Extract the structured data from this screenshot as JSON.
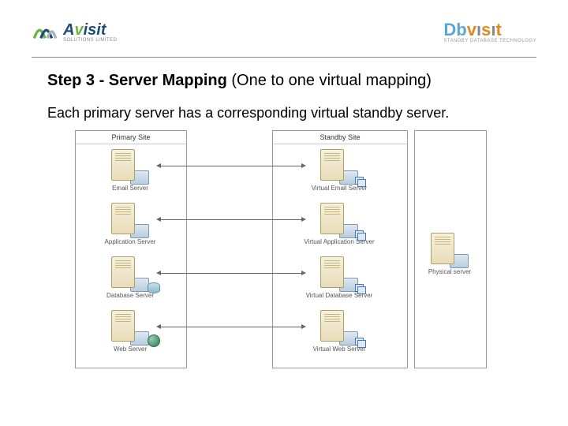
{
  "logos": {
    "avisit": {
      "name": "Avisit",
      "sub": "SOLUTIONS LIMITED"
    },
    "dbvisit": {
      "name": "Dbvisit",
      "sub": "STANDBY DATABASE TECHNOLOGY"
    }
  },
  "title": {
    "bold": "Step 3 - Server Mapping",
    "rest": " (One to one virtual mapping)"
  },
  "description": "Each primary server has a corresponding virtual standby server.",
  "sites": {
    "primary": {
      "title": "Primary Site"
    },
    "standby": {
      "title": "Standby Site"
    },
    "physical": {
      "title": ""
    }
  },
  "servers": {
    "primary": [
      {
        "label": "Email Server"
      },
      {
        "label": "Application Server"
      },
      {
        "label": "Database Server"
      },
      {
        "label": "Web Server"
      }
    ],
    "standby": [
      {
        "label": "Virtual Email Server"
      },
      {
        "label": "Virtual Application Server"
      },
      {
        "label": "Virtual Database Server"
      },
      {
        "label": "Virtual Web Server"
      }
    ],
    "physical": {
      "label": "Physical server"
    }
  }
}
